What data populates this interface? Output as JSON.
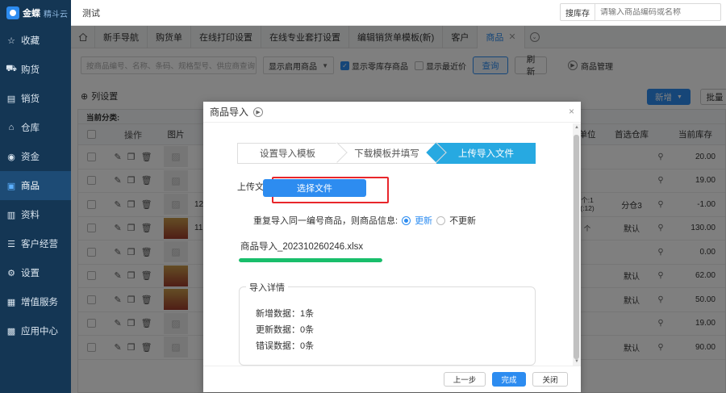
{
  "app": {
    "logo_name": "金蝶",
    "logo_sub": "精斗云",
    "page_title": "测试"
  },
  "global_search": {
    "label": "搜库存",
    "placeholder": "请输入商品编码或名称"
  },
  "sidebar": {
    "items": [
      {
        "label": "收藏",
        "icon": "star-icon"
      },
      {
        "label": "购货",
        "icon": "cart-icon"
      },
      {
        "label": "销货",
        "icon": "sales-icon"
      },
      {
        "label": "仓库",
        "icon": "warehouse-icon"
      },
      {
        "label": "资金",
        "icon": "money-icon"
      },
      {
        "label": "商品",
        "icon": "goods-icon",
        "active": true
      },
      {
        "label": "资料",
        "icon": "document-icon"
      },
      {
        "label": "客户经营",
        "icon": "customer-icon"
      },
      {
        "label": "设置",
        "icon": "settings-icon"
      },
      {
        "label": "增值服务",
        "icon": "service-icon"
      },
      {
        "label": "应用中心",
        "icon": "app-center-icon"
      }
    ]
  },
  "tabs": [
    "新手导航",
    "购货单",
    "在线打印设置",
    "在线专业套打设置",
    "编辑销货单模板(新)",
    "客户",
    "商品"
  ],
  "filter": {
    "search_placeholder": "按商品编号、名称、条码、规格型号、供应商查询",
    "select_value": "显示启用商品",
    "show_zero_stock": "显示零库存商品",
    "show_recent_price": "显示最近价",
    "query": "查询",
    "refresh": "刷新",
    "manage": "商品管理"
  },
  "list": {
    "settings": "列设置",
    "new": "新增",
    "batch": "批量",
    "current_category": "当前分类:"
  },
  "table": {
    "headers": {
      "op": "操作",
      "img": "图片",
      "unit": "单位",
      "warehouse": "首选仓库",
      "stock": "当前库存"
    },
    "rows": [
      {
        "code": "",
        "unit": "",
        "warehouse": "",
        "stock": "20.00",
        "photo": false
      },
      {
        "code": "",
        "unit": "",
        "warehouse": "",
        "stock": "19.00",
        "photo": false
      },
      {
        "code": "12",
        "unit": "个:1\n(:12)",
        "warehouse": "分仓3",
        "stock": "-1.00",
        "photo": false
      },
      {
        "code": "11",
        "unit": "个",
        "warehouse": "默认",
        "stock": "130.00",
        "photo": true
      },
      {
        "code": "",
        "unit": "",
        "warehouse": "",
        "stock": "0.00",
        "photo": false
      },
      {
        "code": "",
        "unit": "",
        "warehouse": "默认",
        "stock": "62.00",
        "photo": true
      },
      {
        "code": "",
        "unit": "",
        "warehouse": "默认",
        "stock": "50.00",
        "photo": true
      },
      {
        "code": "",
        "unit": "",
        "warehouse": "",
        "stock": "19.00",
        "photo": false
      },
      {
        "code": "",
        "unit": "",
        "warehouse": "默认",
        "stock": "90.00",
        "photo": false
      }
    ]
  },
  "modal": {
    "title": "商品导入",
    "steps": [
      "设置导入模板",
      "下载模板并填写",
      "上传导入文件"
    ],
    "upload_label": "上传文件",
    "choose_file": "选择文件",
    "repeat_label": "重复导入同一编号商品，则商品信息:",
    "opt_update": "更新",
    "opt_no_update": "不更新",
    "file_name": "商品导入_202310260246.xlsx",
    "progress": 1.0,
    "detail_title": "导入详情",
    "detail_new": "新增数据：1条",
    "detail_update": "更新数据：0条",
    "detail_error": "错误数据：0条",
    "btn_prev": "上一步",
    "btn_done": "完成",
    "btn_close": "关闭"
  },
  "colors": {
    "sidebar_bg": "#143654",
    "accent": "#2d8cf0",
    "step_active": "#27a9e1",
    "progress": "#19be6b",
    "highlight": "#e8262b"
  }
}
